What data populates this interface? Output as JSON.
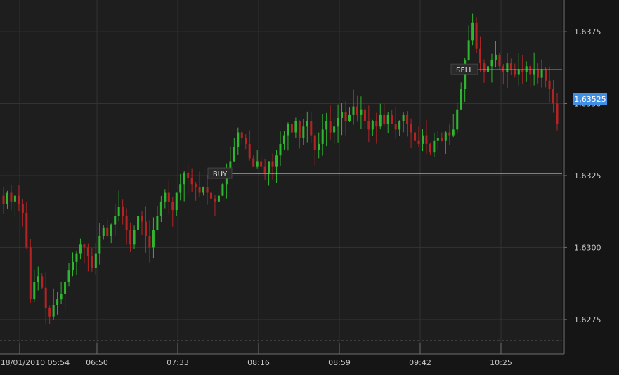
{
  "colors": {
    "background": "#1e1e1e",
    "outer_background": "#151515",
    "grid": "#333333",
    "axis_line": "#6e6e6e",
    "up_candle": "#2fb52f",
    "down_candle": "#b52424",
    "order_line": "#bdbdbd",
    "price_badge": "#3f8fe6"
  },
  "chart_data": {
    "type": "candlestick",
    "instrument_ticks": {
      "y_ticks": [
        "1,6275",
        "1,6300",
        "1,6325",
        "1,6350",
        "1,6375"
      ],
      "y_values": [
        1.6275,
        1.63,
        1.6325,
        1.635,
        1.6375
      ],
      "x_ticks": [
        "18/01/2010 05:54",
        "06:50",
        "07:33",
        "08:16",
        "08:59",
        "09:42",
        "10:25"
      ]
    },
    "ylim": [
      1.6263,
      1.6386
    ],
    "current_price": "1,63525",
    "orders": [
      {
        "label": "BUY",
        "price": 1.63257,
        "from_time": "07:59"
      },
      {
        "label": "SELL",
        "price": 1.63618,
        "from_time": "10:06"
      }
    ],
    "series_closes": [
      1.6315,
      1.6319,
      1.6316,
      1.6318,
      1.6315,
      1.6312,
      1.63,
      1.6282,
      1.6288,
      1.629,
      1.6286,
      1.6279,
      1.6276,
      1.628,
      1.6282,
      1.6284,
      1.6288,
      1.6292,
      1.6295,
      1.6298,
      1.6301,
      1.63,
      1.6297,
      1.6293,
      1.6298,
      1.6304,
      1.6307,
      1.6304,
      1.6308,
      1.6311,
      1.6314,
      1.6311,
      1.6306,
      1.6301,
      1.6306,
      1.6311,
      1.6309,
      1.6304,
      1.63,
      1.6306,
      1.6311,
      1.6316,
      1.6319,
      1.6316,
      1.6313,
      1.6319,
      1.6322,
      1.6326,
      1.6324,
      1.6322,
      1.6321,
      1.6319,
      1.6321,
      1.6319,
      1.6317,
      1.6316,
      1.6318,
      1.6322,
      1.6326,
      1.633,
      1.6335,
      1.634,
      1.6338,
      1.6336,
      1.6331,
      1.6328,
      1.633,
      1.6328,
      1.6326,
      1.633,
      1.6328,
      1.6332,
      1.6336,
      1.6339,
      1.6343,
      1.634,
      1.6344,
      1.6338,
      1.6342,
      1.6344,
      1.6339,
      1.6334,
      1.6336,
      1.6341,
      1.6344,
      1.634,
      1.6342,
      1.6345,
      1.6347,
      1.6344,
      1.6346,
      1.6349,
      1.6346,
      1.6348,
      1.6344,
      1.6341,
      1.6344,
      1.6342,
      1.6346,
      1.6343,
      1.6346,
      1.6343,
      1.6341,
      1.6344,
      1.6346,
      1.6343,
      1.634,
      1.6337,
      1.6336,
      1.6339,
      1.6336,
      1.6333,
      1.6337,
      1.6338,
      1.6337,
      1.634,
      1.6339,
      1.6341,
      1.6348,
      1.6355,
      1.6365,
      1.6372,
      1.6378,
      1.6369,
      1.6364,
      1.6361,
      1.6363,
      1.6365,
      1.6367,
      1.6363,
      1.6361,
      1.6364,
      1.6362,
      1.636,
      1.6362,
      1.6361,
      1.6363,
      1.636,
      1.6362,
      1.6359,
      1.6362,
      1.6358,
      1.6355,
      1.635,
      1.6343
    ]
  },
  "labels": {
    "buy": "BUY",
    "sell": "SELL",
    "price_badge": "1,63525"
  }
}
